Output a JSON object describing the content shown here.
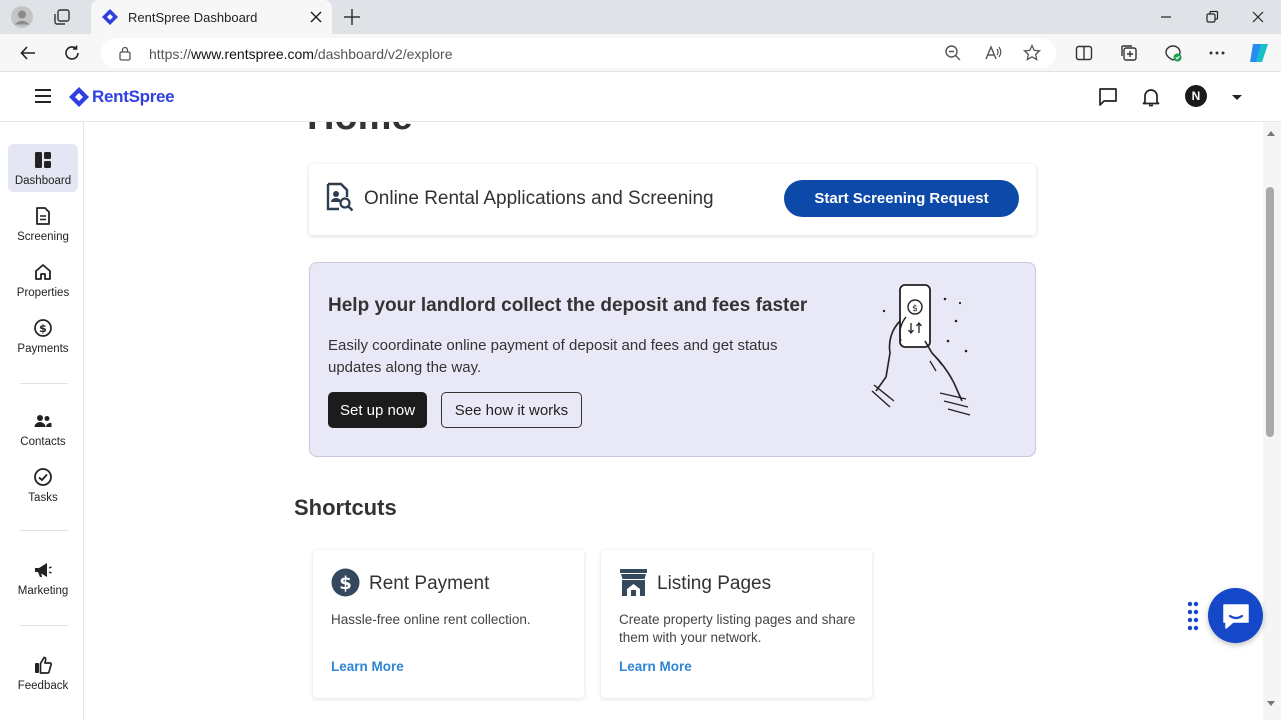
{
  "browser": {
    "tab_title": "RentSpree Dashboard",
    "url_prefix": "https://",
    "url_host": "www.rentspree.com",
    "url_path": "/dashboard/v2/explore",
    "icons": [
      "profile-icon",
      "workspaces-icon",
      "rentspree-favicon",
      "close-icon",
      "plus-icon",
      "minimize-icon",
      "restore-icon",
      "window-close-icon",
      "back-icon",
      "refresh-icon",
      "lock-icon",
      "zoom-icon",
      "read-aloud-icon",
      "favorite-star-icon",
      "split-screen-icon",
      "collections-icon",
      "browser-essentials-icon",
      "more-icon",
      "copilot-icon"
    ]
  },
  "header": {
    "logo_text": "RentSpree",
    "avatar_initial": "N",
    "icons": [
      "hamburger-icon",
      "messages-icon",
      "bell-icon",
      "dropdown-caret-icon"
    ]
  },
  "sidebar": {
    "items": [
      {
        "label": "Dashboard",
        "icon": "dashboard-icon",
        "active": true
      },
      {
        "label": "Screening",
        "icon": "document-icon"
      },
      {
        "label": "Properties",
        "icon": "home-icon"
      },
      {
        "label": "Payments",
        "icon": "dollar-circle-icon"
      },
      {
        "label": "Contacts",
        "icon": "people-icon"
      },
      {
        "label": "Tasks",
        "icon": "check-circle-icon"
      },
      {
        "label": "Marketing",
        "icon": "megaphone-icon"
      },
      {
        "label": "Feedback",
        "icon": "thumbs-up-icon"
      }
    ]
  },
  "main": {
    "page_title": "Home",
    "screening_card": {
      "title": "Online Rental Applications and Screening",
      "button": "Start Screening Request"
    },
    "deposit_card": {
      "title": "Help your landlord collect the deposit and fees faster",
      "description": "Easily coordinate online payment of deposit and fees and get status updates along the way.",
      "primary_button": "Set up now",
      "secondary_button": "See how it works"
    },
    "shortcuts": {
      "title": "Shortcuts",
      "cards": [
        {
          "title": "Rent Payment",
          "description": "Hassle-free online rent collection.",
          "link": "Learn More",
          "icon": "dollar-circle-icon"
        },
        {
          "title": "Listing Pages",
          "description": "Create property listing pages and share them with your network.",
          "link": "Learn More",
          "icon": "storefront-icon"
        }
      ]
    }
  },
  "colors": {
    "brand_blue": "#2f3fe0",
    "primary_button": "#0d49a8",
    "banner_bg": "#e9e8f6",
    "link": "#2e86d4",
    "chat_button": "#1548c8"
  }
}
